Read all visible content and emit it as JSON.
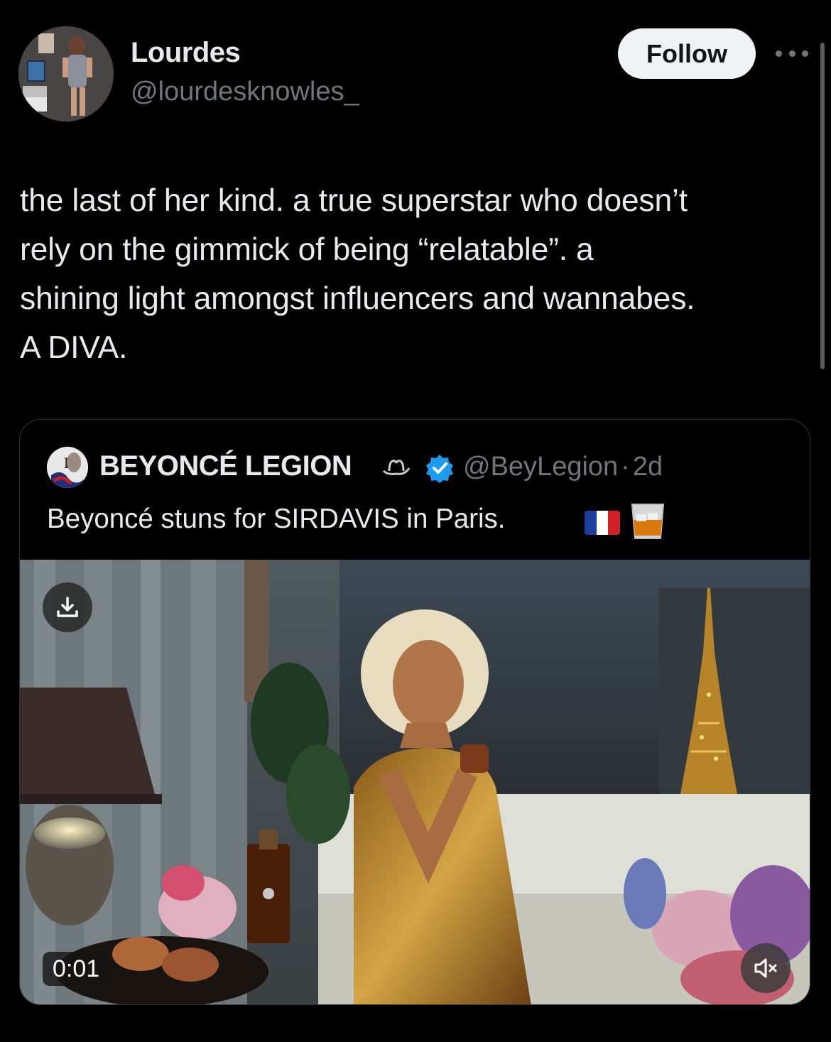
{
  "author": {
    "name": "Lourdes",
    "handle": "@lourdesknowles_",
    "avatar": "profile-photo"
  },
  "follow_label": "Follow",
  "more_icon": "more-horizontal-icon",
  "tweet": {
    "text": "the last of her kind. a true superstar who doesn’t\nrely on the gimmick of being “relatable”. a\nshining light amongst influencers and wannabes.\nA DIVA."
  },
  "quote": {
    "name": "BEYONCÉ LEGION",
    "name_emoji": "cowboy-hat-emoji",
    "verified": true,
    "handle": "@BeyLegion",
    "separator": "·",
    "age": "2d",
    "text": "Beyoncé stuns for SIRDAVIS in Paris.",
    "emojis": [
      "france-flag-emoji",
      "tumbler-glass-emoji"
    ],
    "media": {
      "type": "video",
      "timestamp": "0:01",
      "download_icon": "download-icon",
      "mute_icon": "speaker-muted-icon"
    }
  },
  "colors": {
    "background": "#000000",
    "text_primary": "#e7e9ea",
    "text_secondary": "#71767b",
    "verified": "#1d9bf0",
    "follow_bg": "#eff3f4",
    "border": "#2f3336"
  }
}
